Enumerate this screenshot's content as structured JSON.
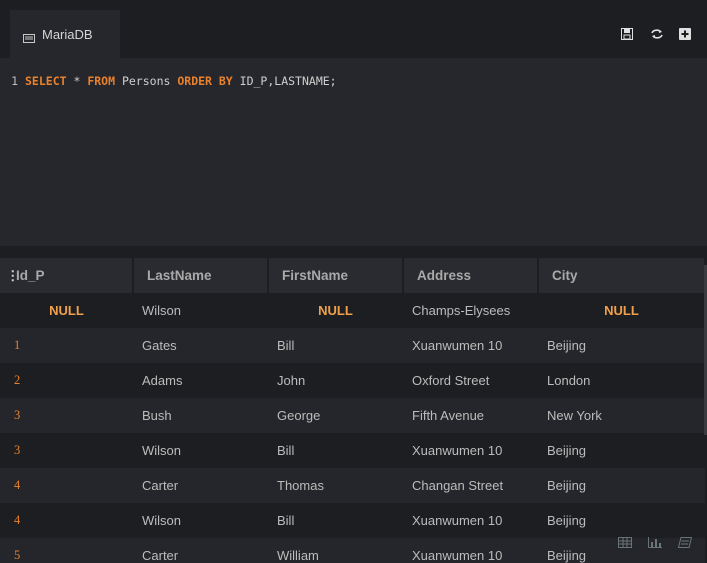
{
  "tab": {
    "label": "MariaDB",
    "icon": "database-icon"
  },
  "toolbar": {
    "icons": [
      "save-icon",
      "refresh-icon",
      "add-icon"
    ]
  },
  "editor": {
    "line_number": "1",
    "tokens": [
      "SELECT",
      " * ",
      "FROM",
      " Persons ",
      "ORDER BY",
      " ID_P,LASTNAME;"
    ]
  },
  "results": {
    "columns": [
      "Id_P",
      "LastName",
      "FirstName",
      "Address",
      "City"
    ],
    "rows": [
      [
        "NULL",
        "Wilson",
        "NULL",
        "Champs-Elysees",
        "NULL"
      ],
      [
        "1",
        "Gates",
        "Bill",
        "Xuanwumen 10",
        "Beijing"
      ],
      [
        "2",
        "Adams",
        "John",
        "Oxford Street",
        "London"
      ],
      [
        "3",
        "Bush",
        "George",
        "Fifth Avenue",
        "New York"
      ],
      [
        "3",
        "Wilson",
        "Bill",
        "Xuanwumen 10",
        "Beijing"
      ],
      [
        "4",
        "Carter",
        "Thomas",
        "Changan Street",
        "Beijing"
      ],
      [
        "4",
        "Wilson",
        "Bill",
        "Xuanwumen 10",
        "Beijing"
      ],
      [
        "5",
        "Carter",
        "William",
        "Xuanwumen 10",
        "Beijing"
      ]
    ]
  },
  "bottom_tools": {
    "icons": [
      "table-view-icon",
      "chart-view-icon",
      "form-view-icon"
    ]
  },
  "colors": {
    "keyword": "#e8812d",
    "null": "#f0a04b",
    "background": "#1d1e22",
    "panel": "#26272c"
  }
}
